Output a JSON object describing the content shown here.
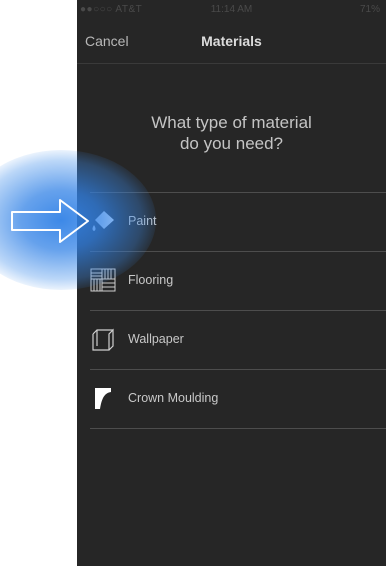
{
  "status_bar": {
    "carrier": "●●○○○ AT&T",
    "time": "11:14 AM",
    "battery": "71%"
  },
  "nav": {
    "cancel_label": "Cancel",
    "title": "Materials"
  },
  "question": {
    "line1": "What type of material",
    "line2": "do you need?"
  },
  "materials": [
    {
      "label": "Paint",
      "icon": "paint-icon"
    },
    {
      "label": "Flooring",
      "icon": "flooring-icon"
    },
    {
      "label": "Wallpaper",
      "icon": "wallpaper-icon"
    },
    {
      "label": "Crown Moulding",
      "icon": "crown-moulding-icon"
    }
  ],
  "colors": {
    "screen_bg": "#262626",
    "highlight_glow": "#3282e6",
    "text": "#c8c8c8"
  }
}
